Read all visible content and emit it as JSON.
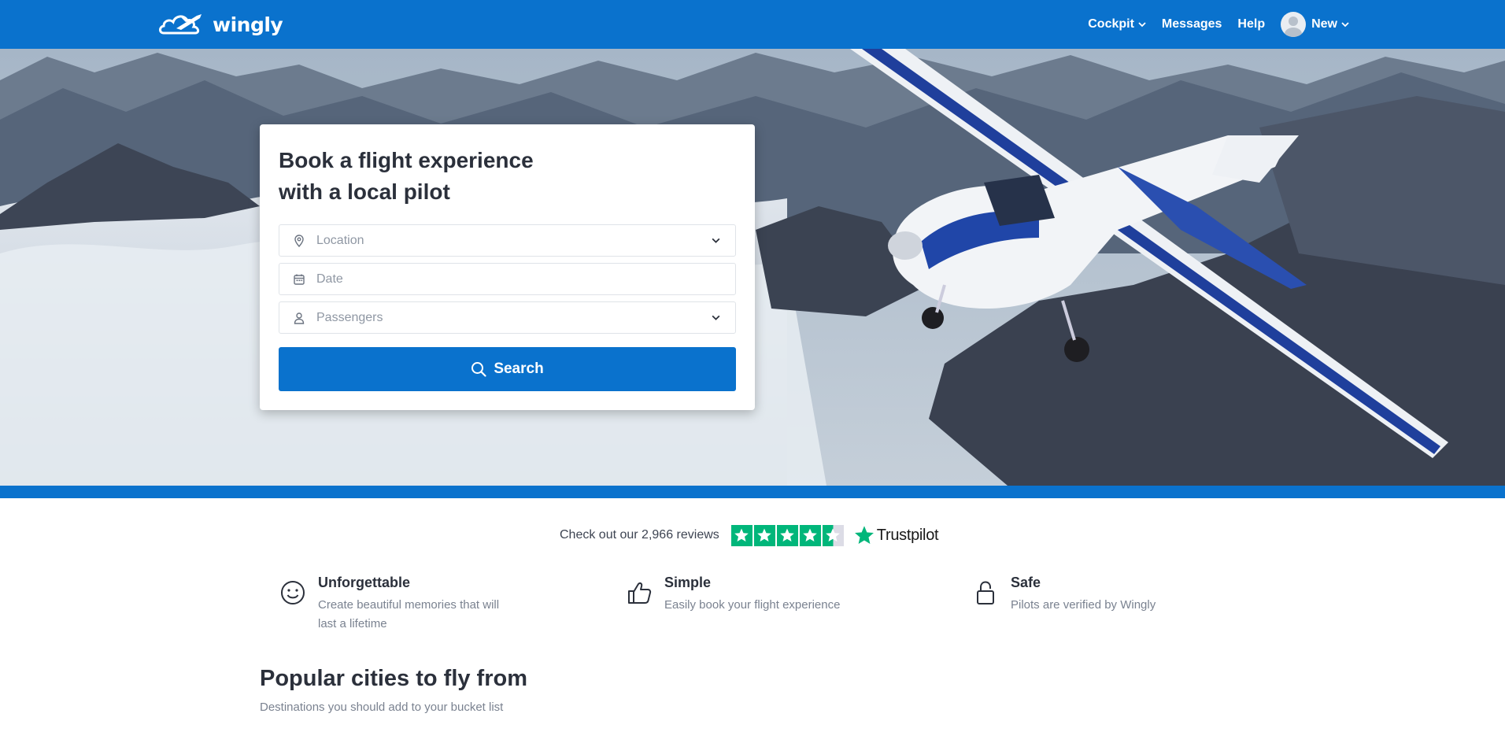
{
  "nav": {
    "brand": "wingly",
    "items": [
      {
        "label": "Cockpit"
      },
      {
        "label": "Messages"
      },
      {
        "label": "Help"
      }
    ],
    "user_label": "New"
  },
  "search_card": {
    "title_line1": "Book a flight experience",
    "title_line2": "with a local pilot",
    "location_placeholder": "Location",
    "date_placeholder": "Date",
    "passengers_placeholder": "Passengers",
    "search_label": "Search"
  },
  "reviews": {
    "text": "Check out our 2,966 reviews",
    "rating_stars": 4.5,
    "brand": "Trustpilot"
  },
  "features": [
    {
      "title": "Unforgettable",
      "desc_line1": "Create beautiful memories that will",
      "desc_line2": "last a lifetime",
      "icon": "smile-icon"
    },
    {
      "title": "Simple",
      "desc_line1": "Easily book your flight experience",
      "desc_line2": "",
      "icon": "thumbs-up-icon"
    },
    {
      "title": "Safe",
      "desc_line1": "Pilots are verified by Wingly",
      "desc_line2": "",
      "icon": "lock-icon"
    }
  ],
  "popular": {
    "title": "Popular cities to fly from",
    "subtitle": "Destinations you should add to your bucket list"
  },
  "colors": {
    "brand_blue": "#0a72cd",
    "trustpilot_green": "#00b67a"
  }
}
